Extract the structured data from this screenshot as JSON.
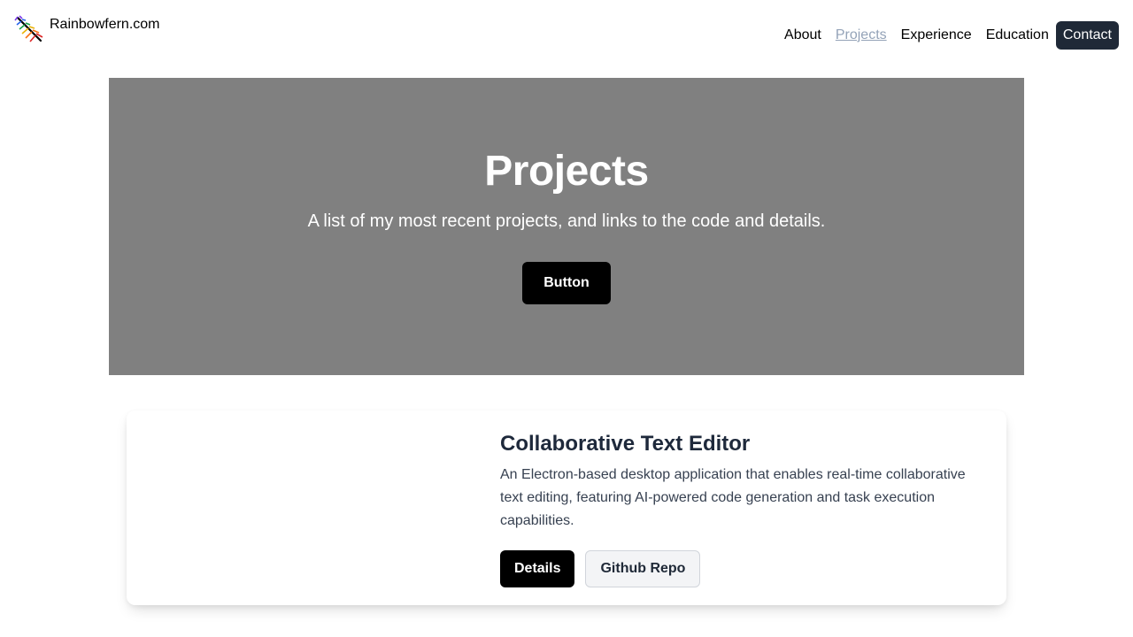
{
  "navbar": {
    "brand": {
      "text": "Rainbowfern.com",
      "logo_icon": "rainbow-fern-logo-icon"
    },
    "links": [
      {
        "label": "About",
        "active": false
      },
      {
        "label": "Projects",
        "active": true
      },
      {
        "label": "Experience",
        "active": false
      },
      {
        "label": "Education",
        "active": false
      }
    ],
    "contact_label": "Contact"
  },
  "hero": {
    "title": "Projects",
    "subtitle": "A list of my most recent projects, and links to the code and details.",
    "button_label": "Button"
  },
  "projects": [
    {
      "title": "Collaborative Text Editor",
      "description": "An Electron-based desktop application that enables real-time collaborative text editing, featuring AI-powered code generation and task execution capabilities.",
      "details_label": "Details",
      "github_label": "Github Repo"
    }
  ],
  "colors": {
    "hero_bg": "#808080",
    "primary_button": "#000000",
    "contact_bg": "#1f2937",
    "active_link": "#94a3b8"
  }
}
